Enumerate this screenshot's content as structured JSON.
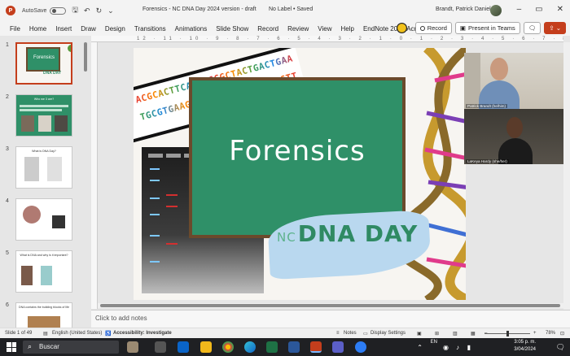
{
  "titlebar": {
    "autosave_label": "AutoSave",
    "toggle_state": "Off",
    "doc_title": "Forensics - NC DNA Day 2024 version - draft",
    "label": "No Label • Saved",
    "user_name": "Brandt, Patrick Daniel"
  },
  "ribbon": {
    "tabs": [
      "File",
      "Home",
      "Insert",
      "Draw",
      "Design",
      "Transitions",
      "Animations",
      "Slide Show",
      "Record",
      "Review",
      "View",
      "Help",
      "EndNote 20",
      "Acrobat"
    ],
    "record_label": "Record",
    "teams_label": "Present in Teams"
  },
  "thumbnails": [
    {
      "num": "1",
      "text": "Forensics"
    },
    {
      "num": "2",
      "text": "Who we 3 are?"
    },
    {
      "num": "3",
      "text": "What is DNA Day?"
    },
    {
      "num": "4",
      "text": ""
    },
    {
      "num": "5",
      "text": "What is DNA and why is it important?"
    },
    {
      "num": "6",
      "text": "DNA contains the building blocks of life"
    }
  ],
  "ruler_marks": "12 · 11 · 10 · 9 · 8 · 7 · 6 · 5 · 4 · 3 · 2 · 1 · 0 · 1 · 2 · 3 · 4 · 5 · 6 · 7 · 8 · 9 · 10 · 11 · 12",
  "slide": {
    "seq_top": "ACGCACTTCAGAACCGCTACTGACTGAA",
    "seq_bottom": "TGCGTGAAGTCTTGGCGATGACTGACTT",
    "board_title": "Forensics",
    "nc_prefix": "NC",
    "logo_text": "DNA DAY"
  },
  "video": {
    "participant1": "Patrick Brandt (he/him)",
    "participant2": "LaKeya Hardy (she/her)"
  },
  "notes_placeholder": "Click to add notes",
  "status": {
    "slide_count": "Slide 1 of 49",
    "language": "English (United States)",
    "accessibility": "Accessibility: Investigate",
    "notes": "Notes",
    "display_settings": "Display Settings",
    "zoom": "78%"
  },
  "taskbar": {
    "search": "Buscar",
    "lang": "EN",
    "time": "3:05 p. m.",
    "date": "3/04/2024"
  },
  "colors": {
    "accent": "#c43e1c",
    "board": "#2f9068",
    "dna_day": "#2f8a63"
  }
}
